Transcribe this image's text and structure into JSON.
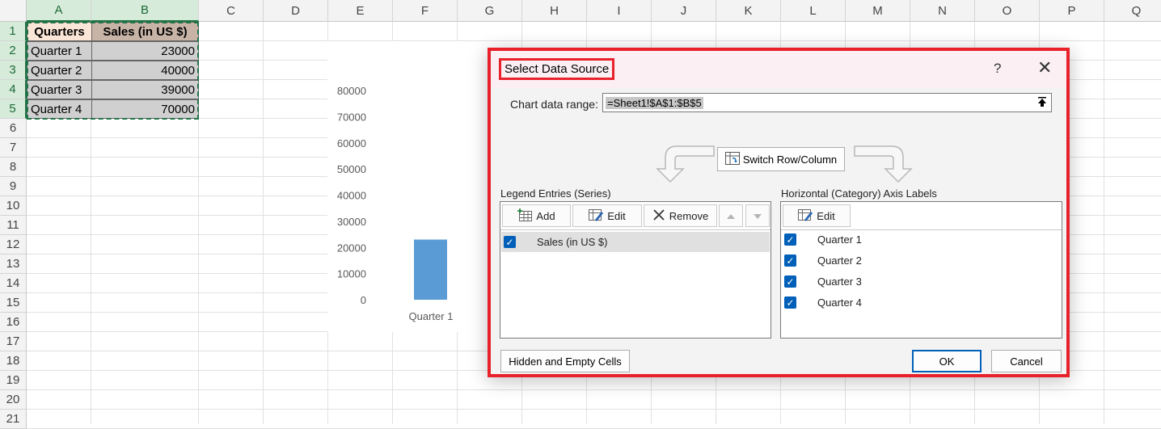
{
  "sheet": {
    "columns": [
      "A",
      "B",
      "C",
      "D",
      "E",
      "F",
      "G",
      "H",
      "I",
      "J",
      "K",
      "L",
      "M",
      "N",
      "O",
      "P",
      "Q"
    ],
    "rows": [
      "1",
      "2",
      "3",
      "4",
      "5",
      "6",
      "7",
      "8",
      "9",
      "10",
      "11",
      "12",
      "13",
      "14",
      "15",
      "16",
      "17",
      "18",
      "19",
      "20",
      "21"
    ],
    "table": {
      "headers": [
        "Quarters",
        "Sales (in US $)"
      ],
      "data": [
        [
          "Quarter 1",
          "23000"
        ],
        [
          "Quarter 2",
          "40000"
        ],
        [
          "Quarter 3",
          "39000"
        ],
        [
          "Quarter 4",
          "70000"
        ]
      ]
    }
  },
  "chart_data": {
    "type": "bar",
    "categories": [
      "Quarter 1"
    ],
    "values": [
      23000
    ],
    "ylim": [
      0,
      80000
    ],
    "yticks": [
      "80000",
      "70000",
      "60000",
      "50000",
      "40000",
      "30000",
      "20000",
      "10000",
      "0"
    ],
    "bar_color": "#5b9bd5"
  },
  "dialog": {
    "title": "Select Data Source",
    "help_label": "?",
    "close_label": "✕",
    "range_label": "Chart data range:",
    "range_value": "=Sheet1!$A$1:$B$5",
    "switch_label": "Switch Row/Column",
    "legend_label": "Legend Entries (Series)",
    "axis_label": "Horizontal (Category) Axis Labels",
    "add_label": "Add",
    "edit_label": "Edit",
    "remove_label": "Remove",
    "axis_edit_label": "Edit",
    "series": [
      "Sales (in US $)"
    ],
    "categories": [
      "Quarter 1",
      "Quarter 2",
      "Quarter 3",
      "Quarter 4"
    ],
    "hidden_cells_label": "Hidden and Empty Cells",
    "ok_label": "OK",
    "cancel_label": "Cancel",
    "highlight_color": "#e8212b",
    "accent_color": "#005fb8"
  }
}
